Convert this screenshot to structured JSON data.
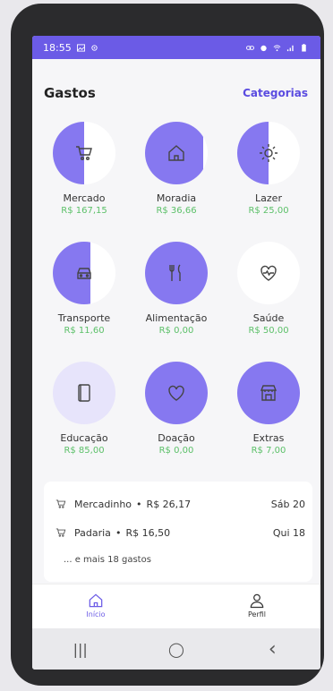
{
  "status_bar": {
    "time": "18:55"
  },
  "header": {
    "title": "Gastos",
    "categories_link": "Categorias"
  },
  "colors": {
    "accent": "#8678f0",
    "accent_dark": "#6b5be6",
    "value_green": "#5cc069"
  },
  "categories": [
    {
      "name": "Mercado",
      "value": "R$ 167,15",
      "icon": "cart-icon",
      "fill_fraction": 0.5
    },
    {
      "name": "Moradia",
      "value": "R$ 36,66",
      "icon": "home-icon",
      "fill_fraction": 0.93
    },
    {
      "name": "Lazer",
      "value": "R$ 25,00",
      "icon": "sun-icon",
      "fill_fraction": 0.5
    },
    {
      "name": "Transporte",
      "value": "R$ 11,60",
      "icon": "car-icon",
      "fill_fraction": 0.6
    },
    {
      "name": "Alimentação",
      "value": "R$ 0,00",
      "icon": "utensils-icon",
      "fill_fraction": 1.0
    },
    {
      "name": "Saúde",
      "value": "R$ 50,00",
      "icon": "health-heart-icon",
      "fill_fraction": 0.0
    },
    {
      "name": "Educação",
      "value": "R$ 85,00",
      "icon": "book-icon",
      "fill_fraction": 0.15
    },
    {
      "name": "Doação",
      "value": "R$ 0,00",
      "icon": "heart-icon",
      "fill_fraction": 1.0
    },
    {
      "name": "Extras",
      "value": "R$ 7,00",
      "icon": "store-icon",
      "fill_fraction": 1.0
    }
  ],
  "recent": {
    "items": [
      {
        "name": "Mercadinho",
        "value": "R$ 26,17",
        "date": "Sáb 20",
        "icon": "cart-icon"
      },
      {
        "name": "Padaria",
        "value": "R$ 16,50",
        "date": "Qui 18",
        "icon": "cart-icon"
      }
    ],
    "more": "... e mais 18 gastos"
  },
  "tabs": [
    {
      "label": "Início",
      "icon": "home-icon",
      "active": true
    },
    {
      "label": "Perfil",
      "icon": "user-icon",
      "active": false
    }
  ],
  "nav": {
    "recent": "|||",
    "home": "◯",
    "back": "‹"
  }
}
